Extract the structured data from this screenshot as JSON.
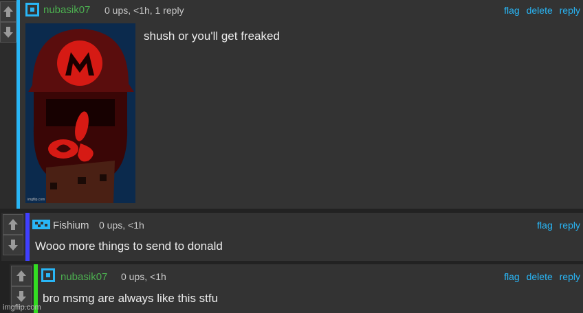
{
  "comments": [
    {
      "username": "nubasik07",
      "meta": "0 ups, <1h, 1 reply",
      "actions": [
        "flag",
        "delete",
        "reply"
      ],
      "text": "shush or you'll get freaked",
      "accent_color": "#29b6f6",
      "username_color": "#4caf50",
      "image_watermark": "imgflip.com"
    },
    {
      "username": "Fishium",
      "meta": "0 ups, <1h",
      "actions": [
        "flag",
        "reply"
      ],
      "text": "Wooo more things to send to donald",
      "accent_color": "#3f3fff",
      "username_color": "#cfcfcf"
    },
    {
      "username": "nubasik07",
      "meta": "0 ups, <1h",
      "actions": [
        "flag",
        "delete",
        "reply"
      ],
      "text": "bro msmg are always like this stfu",
      "accent_color": "#33dd22",
      "username_color": "#4caf50"
    }
  ],
  "watermark": "imgflip.com"
}
